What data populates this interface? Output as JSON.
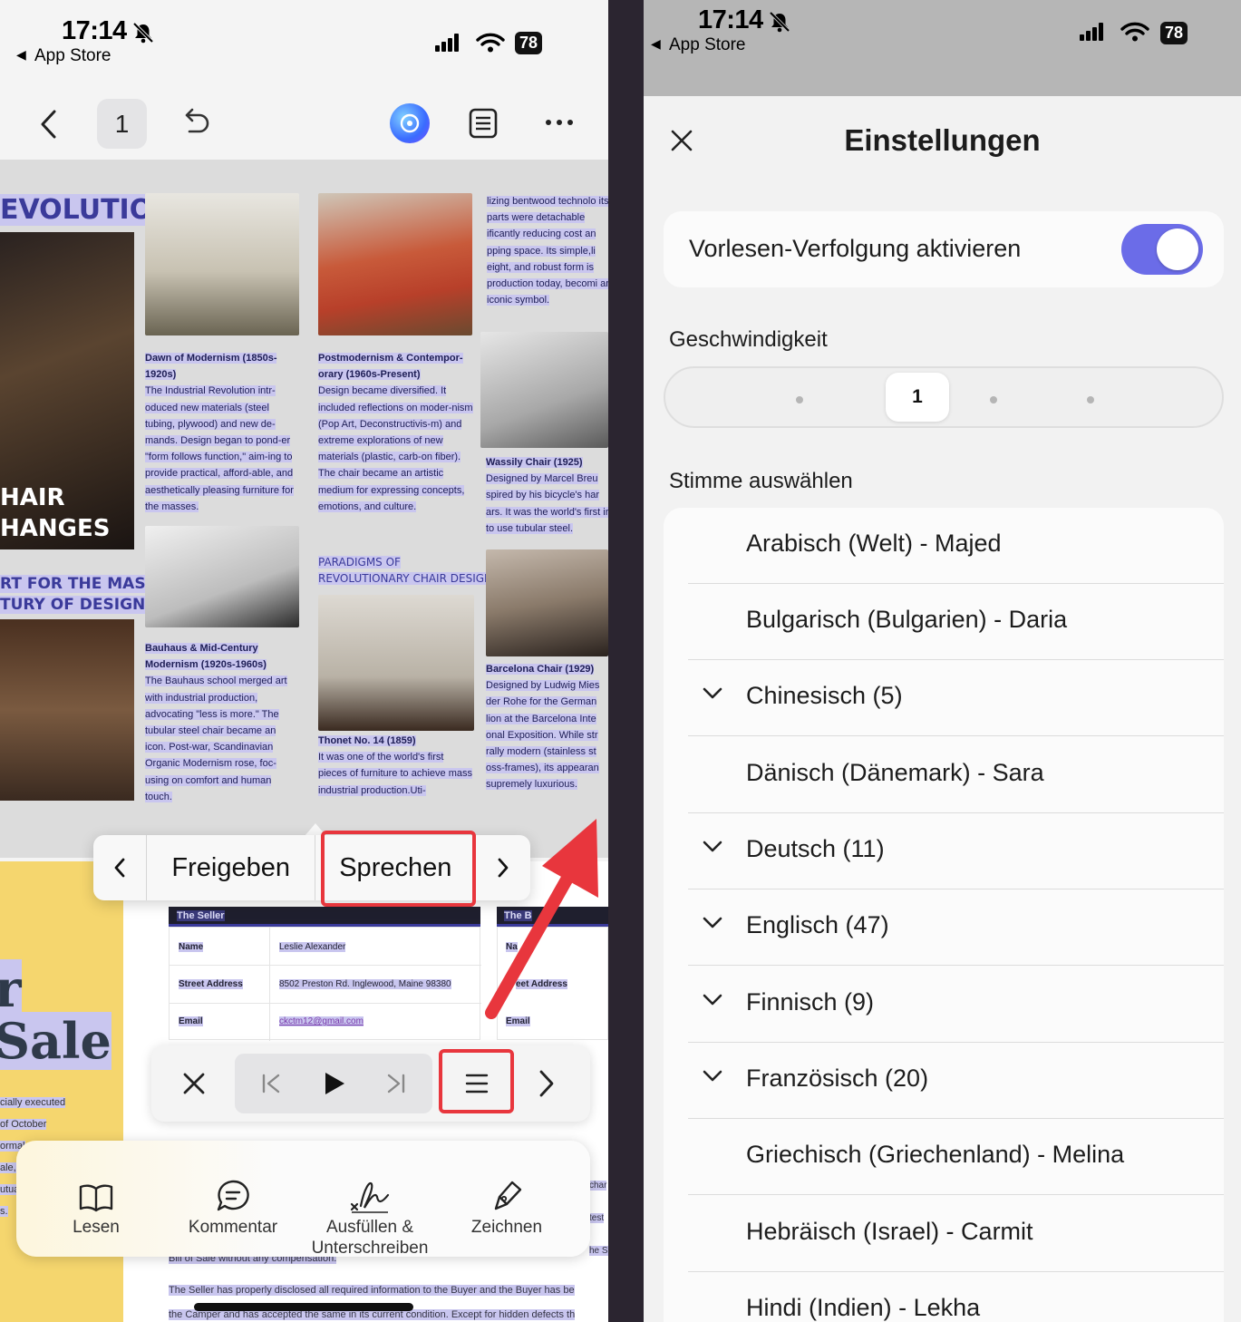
{
  "left": {
    "status": {
      "time": "17:14",
      "back_label": "App Store",
      "battery": "78"
    },
    "toolbar": {
      "page_number": "1"
    },
    "doc": {
      "title_evolution": "EVOLUTION:",
      "chair_line1": "HAIR",
      "chair_line2": "HANGES",
      "subtitle1": "RT FOR THE MASSES:",
      "subtitle2": "TURY OF DESIGN",
      "col1_top_heading": "Dawn of Modernism (1850s-1920s)",
      "col1_top_body": "The Industrial Revolution intr-oduced new materials (steel tubing, plywood) and new de-mands. Design began to pond-er \"form follows function,\" aim-ing to provide practical, afford-able, and aesthetically pleasing furniture for the masses.",
      "col1_bottom_heading": "Bauhaus & Mid-Century Modernism (1920s-1960s)",
      "col1_bottom_body": "The Bauhaus school merged art with industrial production, advocating \"less is more.\" The tubular steel chair became an icon. Post-war, Scandinavian Organic Modernism rose, foc-using on comfort and human touch.",
      "col2_top_heading": "Postmodernism & Contempor-orary (1960s-Present)",
      "col2_top_body": "Design became diversified. It included reflections on moder-nism (Pop Art, Deconstructivis-m) and extreme explorations of new materials (plastic, carb-on fiber). The chair became an artistic medium for expressing concepts, emotions, and culture.",
      "paradigms_1": "PARADIGMS OF",
      "paradigms_2": "REVOLUTIONARY CHAIR DESIGN",
      "col2_bottom_heading": "Thonet No. 14 (1859)",
      "col2_bottom_body": "It was one of the world's first pieces of furniture to achieve mass industrial production.Uti-",
      "col3_top_body": "lizing bentwood technolo its parts were detachable ificantly reducing cost an pping space. Its simple,li eight, and robust form is production today, becomi an iconic symbol.",
      "col3_mid_heading": "Wassily Chair (1925)",
      "col3_mid_body": "Designed by Marcel Breu spired by his bicycle's har ars. It was the world's first ir to use tubular steel.",
      "col3_bottom_heading": "Barcelona Chair (1929)",
      "col3_bottom_body": "Designed by Ludwig Mies der Rohe for the German lion at the Barcelona Inte onal Exposition. While str rally modern (stainless st oss-frames), its appearan supremely luxurious."
    },
    "doc2": {
      "sale_word1": "r",
      "sale_word2": "Sale",
      "left_lines": [
        "cially executed",
        "of October",
        "ormal",
        "ale,",
        "utua",
        "s."
      ],
      "table_header1": "The Seller",
      "table_header2": "The B",
      "rows": [
        {
          "label": "Name",
          "value": "Leslie Alexander",
          "label2": "Na"
        },
        {
          "label": "Street Address",
          "value": "8502 Preston Rd. Inglewood, Maine 98380",
          "label2": "eet Address"
        },
        {
          "label": "Email",
          "value": "ckctm12@gmail.com",
          "label2": "Email"
        }
      ],
      "right_frag": [
        "char",
        "test",
        "he S"
      ],
      "bottom_line1": "Bill of Sale without any compensation.",
      "bottom_line2": "The Seller has properly disclosed all required information to the Buyer and the Buyer has be",
      "bottom_line3": "the Camper and has accepted the same in its current condition. Except for hidden defects th"
    },
    "popup": {
      "share": "Freigeben",
      "speak": "Sprechen"
    },
    "bottombar": {
      "read": "Lesen",
      "comment": "Kommentar",
      "fill_sign_1": "Ausfüllen &",
      "fill_sign_2": "Unterschreiben",
      "draw": "Zeichnen"
    }
  },
  "right": {
    "status": {
      "time": "17:14",
      "back_label": "App Store",
      "battery": "78"
    },
    "title": "Einstellungen",
    "tracking_label": "Vorlesen-Verfolgung aktivieren",
    "tracking_enabled": true,
    "speed_label": "Geschwindigkeit",
    "speed_value": "1",
    "voice_label": "Stimme auswählen",
    "voices": [
      {
        "name": "Arabisch (Welt) - Majed",
        "expandable": false
      },
      {
        "name": "Bulgarisch (Bulgarien) - Daria",
        "expandable": false
      },
      {
        "name": "Chinesisch (5)",
        "expandable": true
      },
      {
        "name": "Dänisch (Dänemark) - Sara",
        "expandable": false
      },
      {
        "name": "Deutsch (11)",
        "expandable": true
      },
      {
        "name": "Englisch (47)",
        "expandable": true
      },
      {
        "name": "Finnisch (9)",
        "expandable": true
      },
      {
        "name": "Französisch (20)",
        "expandable": true
      },
      {
        "name": "Griechisch (Griechenland) - Melina",
        "expandable": false
      },
      {
        "name": "Hebräisch (Israel) - Carmit",
        "expandable": false
      },
      {
        "name": "Hindi (Indien) - Lekha",
        "expandable": false
      }
    ]
  },
  "colors": {
    "accent_toggle": "#6b6ce8",
    "highlight": "#e8363d",
    "doc_text": "#1e1e55"
  }
}
